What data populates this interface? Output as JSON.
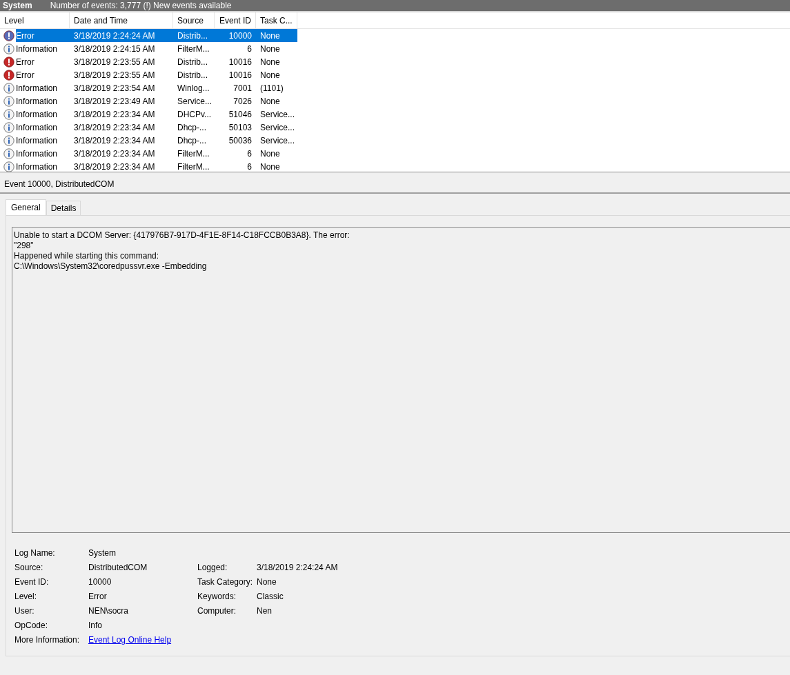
{
  "header": {
    "log": "System",
    "status": "Number of events: 3,777 (!) New events available"
  },
  "table": {
    "columns": [
      "Level",
      "Date and Time",
      "Source",
      "Event ID",
      "Task C..."
    ],
    "rows": [
      {
        "kind": "error",
        "level": "Error",
        "date": "3/18/2019 2:24:24 AM",
        "source": "Distrib...",
        "event_id": "10000",
        "task": "None",
        "selected": true
      },
      {
        "kind": "information",
        "level": "Information",
        "date": "3/18/2019 2:24:15 AM",
        "source": "FilterM...",
        "event_id": "6",
        "task": "None",
        "selected": false
      },
      {
        "kind": "error",
        "level": "Error",
        "date": "3/18/2019 2:23:55 AM",
        "source": "Distrib...",
        "event_id": "10016",
        "task": "None",
        "selected": false
      },
      {
        "kind": "error",
        "level": "Error",
        "date": "3/18/2019 2:23:55 AM",
        "source": "Distrib...",
        "event_id": "10016",
        "task": "None",
        "selected": false
      },
      {
        "kind": "information",
        "level": "Information",
        "date": "3/18/2019 2:23:54 AM",
        "source": "Winlog...",
        "event_id": "7001",
        "task": "(1101)",
        "selected": false
      },
      {
        "kind": "information",
        "level": "Information",
        "date": "3/18/2019 2:23:49 AM",
        "source": "Service...",
        "event_id": "7026",
        "task": "None",
        "selected": false
      },
      {
        "kind": "information",
        "level": "Information",
        "date": "3/18/2019 2:23:34 AM",
        "source": "DHCPv...",
        "event_id": "51046",
        "task": "Service...",
        "selected": false
      },
      {
        "kind": "information",
        "level": "Information",
        "date": "3/18/2019 2:23:34 AM",
        "source": "Dhcp-...",
        "event_id": "50103",
        "task": "Service...",
        "selected": false
      },
      {
        "kind": "information",
        "level": "Information",
        "date": "3/18/2019 2:23:34 AM",
        "source": "Dhcp-...",
        "event_id": "50036",
        "task": "Service...",
        "selected": false
      },
      {
        "kind": "information",
        "level": "Information",
        "date": "3/18/2019 2:23:34 AM",
        "source": "FilterM...",
        "event_id": "6",
        "task": "None",
        "selected": false
      },
      {
        "kind": "information",
        "level": "Information",
        "date": "3/18/2019 2:23:34 AM",
        "source": "FilterM...",
        "event_id": "6",
        "task": "None",
        "selected": false
      }
    ]
  },
  "detail": {
    "title": "Event 10000, DistributedCOM",
    "tabs": [
      {
        "label": "General",
        "selected": true
      },
      {
        "label": "Details",
        "selected": false
      }
    ],
    "message": [
      "Unable to start a DCOM Server: {417976B7-917D-4F1E-8F14-C18FCCB0B3A8}. The error:",
      "\"298\"",
      "Happened while starting this command:",
      "C:\\Windows\\System32\\coredpussvr.exe -Embedding"
    ],
    "properties": [
      [
        {
          "label": "Log Name:",
          "value": "System"
        }
      ],
      [
        {
          "label": "Source:",
          "value": "DistributedCOM"
        },
        {
          "label": "Logged:",
          "value": "3/18/2019 2:24:24 AM"
        }
      ],
      [
        {
          "label": "Event ID:",
          "value": "10000"
        },
        {
          "label": "Task Category:",
          "value": "None"
        }
      ],
      [
        {
          "label": "Level:",
          "value": "Error"
        },
        {
          "label": "Keywords:",
          "value": "Classic"
        }
      ],
      [
        {
          "label": "User:",
          "value": "NEN\\socra"
        },
        {
          "label": "Computer:",
          "value": "Nen"
        }
      ],
      [
        {
          "label": "OpCode:",
          "value": "Info"
        }
      ],
      [
        {
          "label": "More Information:",
          "link": "Event Log Online Help"
        }
      ]
    ]
  }
}
